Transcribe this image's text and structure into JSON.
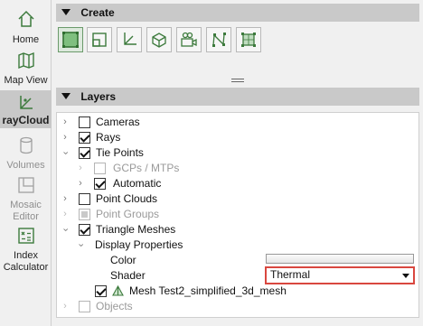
{
  "sidebar": {
    "items": [
      {
        "label": "Home",
        "icon": "home-icon",
        "state": "normal"
      },
      {
        "label": "Map View",
        "icon": "map-icon",
        "state": "normal"
      },
      {
        "label": "rayCloud",
        "icon": "raycloud-icon",
        "state": "active"
      },
      {
        "label": "Volumes",
        "icon": "volumes-icon",
        "state": "disabled"
      },
      {
        "label": "Mosaic Editor",
        "icon": "mosaic-editor-icon",
        "state": "disabled"
      },
      {
        "label": "Index Calculator",
        "icon": "index-calculator-icon",
        "state": "normal"
      }
    ]
  },
  "create": {
    "title": "Create",
    "tools": [
      {
        "icon": "select-rectangle-icon",
        "selected": true
      },
      {
        "icon": "crop-box-icon",
        "selected": false
      },
      {
        "icon": "axes-icon",
        "selected": false
      },
      {
        "icon": "cube-icon",
        "selected": false
      },
      {
        "icon": "video-camera-icon",
        "selected": false
      },
      {
        "icon": "polyline-icon",
        "selected": false
      },
      {
        "icon": "surface-icon",
        "selected": false
      }
    ]
  },
  "layers": {
    "title": "Layers",
    "items": {
      "cameras": "Cameras",
      "rays": "Rays",
      "tie_points": "Tie Points",
      "gcps": "GCPs / MTPs",
      "automatic": "Automatic",
      "point_clouds": "Point Clouds",
      "point_groups": "Point Groups",
      "triangle_meshes": "Triangle Meshes",
      "display_properties": "Display Properties",
      "color_label": "Color",
      "shader_label": "Shader",
      "shader_value": "Thermal",
      "mesh": "Mesh Test2_simplified_3d_mesh",
      "objects": "Objects"
    }
  },
  "colors": {
    "accent_highlight": "#d9473f",
    "icon_green": "#3c7a3c",
    "header_bg": "#c9c9c9"
  }
}
